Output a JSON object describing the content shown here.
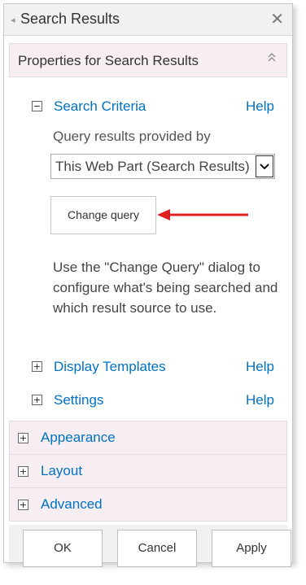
{
  "panel": {
    "title": "Search Results",
    "close_icon": "✕",
    "back_icon": "◂"
  },
  "properties_header": {
    "label": "Properties for Search Results",
    "collapse_icon": "⌃⌃"
  },
  "search_criteria": {
    "label": "Search Criteria",
    "help": "Help",
    "toggle": "−",
    "query_label": "Query results provided by",
    "query_value": "This Web Part (Search Results)",
    "change_query_button": "Change query",
    "description": "Use the \"Change Query\" dialog to configure what's being searched and which result source to use."
  },
  "display_templates": {
    "label": "Display Templates",
    "help": "Help",
    "toggle": "+"
  },
  "settings": {
    "label": "Settings",
    "help": "Help",
    "toggle": "+"
  },
  "bands": [
    {
      "label": "Appearance",
      "toggle": "+"
    },
    {
      "label": "Layout",
      "toggle": "+"
    },
    {
      "label": "Advanced",
      "toggle": "+"
    }
  ],
  "footer": {
    "ok": "OK",
    "cancel": "Cancel",
    "apply": "Apply"
  },
  "colors": {
    "link": "#0072c6",
    "annotation_arrow": "#e02020",
    "band_bg": "#f6eef2"
  }
}
